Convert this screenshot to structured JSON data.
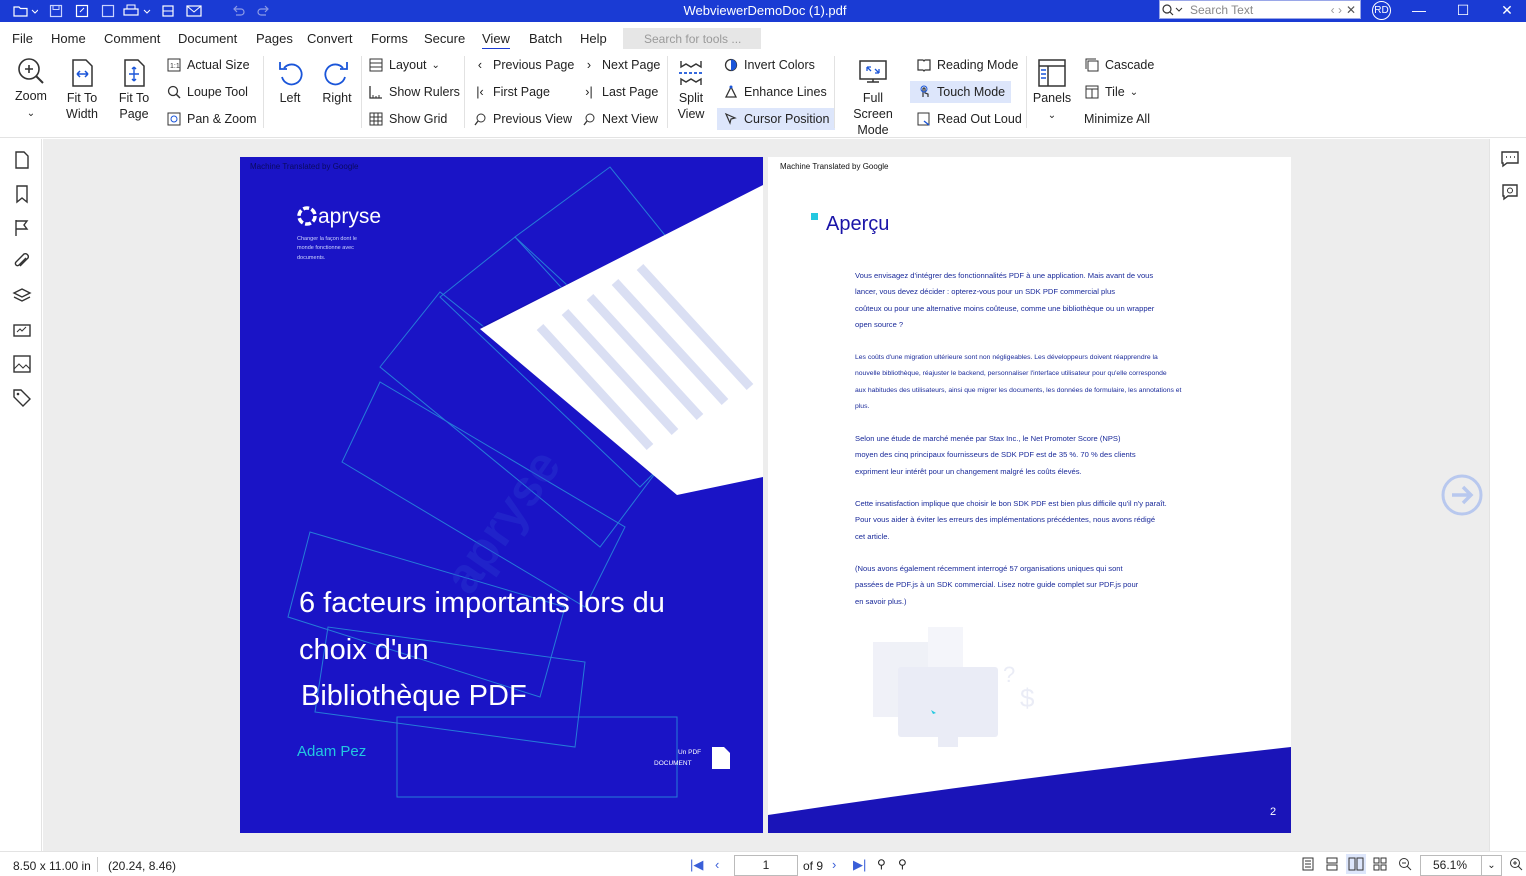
{
  "window": {
    "title": "WebviewerDemoDoc (1).pdf",
    "search_placeholder": "Search Text",
    "avatar": "RD"
  },
  "menu": [
    "File",
    "Home",
    "Comment",
    "Document",
    "Pages",
    "Convert",
    "Forms",
    "Secure",
    "View",
    "Batch",
    "Help"
  ],
  "tool_search_placeholder": "Search for tools ...",
  "ribbon": {
    "zoom": "Zoom",
    "fit_width": [
      "Fit To",
      "Width"
    ],
    "fit_page": [
      "Fit To",
      "Page"
    ],
    "actual_size": "Actual Size",
    "loupe_tool": "Loupe Tool",
    "pan_zoom": "Pan & Zoom",
    "rotate_left": "Left",
    "rotate_right": "Right",
    "layout": "Layout",
    "show_rulers": "Show Rulers",
    "show_grid": "Show Grid",
    "previous_page": "Previous Page",
    "first_page": "First Page",
    "previous_view": "Previous View",
    "next_page": "Next Page",
    "last_page": "Last Page",
    "next_view": "Next View",
    "split_view": [
      "Split",
      "View"
    ],
    "invert_colors": "Invert Colors",
    "enhance_lines": "Enhance Lines",
    "cursor_position": "Cursor Position",
    "full_screen": [
      "Full Screen",
      "Mode"
    ],
    "reading_mode": "Reading Mode",
    "touch_mode": "Touch Mode",
    "read_out_loud": "Read Out Loud",
    "panels": "Panels",
    "cascade": "Cascade",
    "tile": "Tile",
    "minimize_all": "Minimize All"
  },
  "page1": {
    "watermark": "Machine Translated by Google",
    "brand": "apryse",
    "tagline": [
      "Changer la façon dont le",
      "monde fonctionne avec",
      "documents."
    ],
    "title_lines": [
      "6 facteurs importants lors du",
      "choix d'un",
      "Bibliothèque PDF"
    ],
    "author": "Adam Pez",
    "doc_label": [
      "Un PDF",
      "DOCUMENT"
    ],
    "diagonal_watermark": "apryse"
  },
  "page2": {
    "watermark": "Machine Translated by Google",
    "heading": "Aperçu",
    "p1": [
      "Vous envisagez d'intégrer des fonctionnalités PDF à une application. Mais avant de vous",
      "lancer, vous devez décider : opterez-vous pour un SDK PDF commercial plus",
      "coûteux ou pour une alternative moins coûteuse, comme une bibliothèque ou un wrapper",
      "open source ?"
    ],
    "p2": [
      "Les coûts d'une migration ultérieure sont non négligeables. Les développeurs doivent réapprendre la",
      "nouvelle bibliothèque, réajuster le backend, personnaliser l'interface utilisateur pour qu'elle corresponde",
      "aux habitudes des utilisateurs, ainsi que migrer les documents, les données de formulaire, les annotations et",
      "plus."
    ],
    "p3": [
      "Selon une étude de marché menée par Stax Inc., le Net Promoter Score (NPS)",
      "moyen des cinq principaux fournisseurs de SDK PDF est de 35 %. 70 % des clients",
      "expriment leur intérêt pour un changement malgré les coûts élevés."
    ],
    "p4": [
      "Cette insatisfaction implique que choisir le bon SDK PDF est bien plus difficile qu'il n'y paraît.",
      "Pour vous aider à éviter les erreurs des implémentations précédentes, nous avons rédigé",
      "cet article."
    ],
    "p5": [
      "(Nous avons également récemment interrogé 57 organisations uniques qui sont",
      "passées de PDF.js à un SDK commercial. Lisez notre guide complet sur PDF.js pour",
      "en savoir plus.)"
    ],
    "page_number": "2"
  },
  "status": {
    "page_size": "8.50 x 11.00 in",
    "cursor": "(20.24, 8.46)",
    "current_page": "1",
    "of_pages": "of 9",
    "zoom": "56.1%"
  },
  "colors": {
    "titlebar": "#1a3bd4",
    "cover": "#1a14c6",
    "accent": "#23c8e0"
  }
}
